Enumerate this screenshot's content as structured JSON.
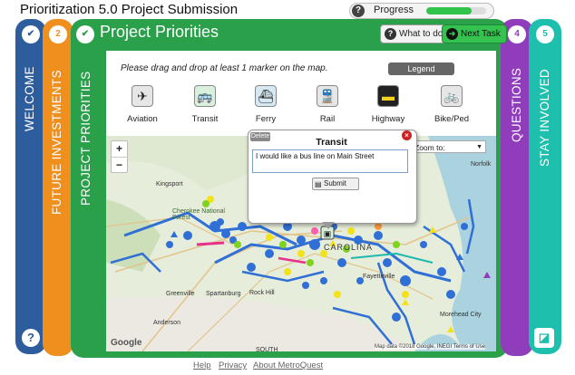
{
  "app": {
    "title": "Prioritization 5.0 Project Submission"
  },
  "progress": {
    "help_icon": "?",
    "label": "Progress",
    "fraction": 0.75
  },
  "tabs": {
    "welcome": {
      "label": "WELCOME",
      "badge": "✔"
    },
    "future": {
      "label": "FUTURE INVESTMENTS",
      "badge": "2"
    },
    "priorities": {
      "label": "PROJECT PRIORITIES",
      "badge": "✔"
    },
    "questions": {
      "label": "QUESTIONS",
      "badge": "4"
    },
    "stay": {
      "label": "STAY INVOLVED",
      "badge": "5"
    }
  },
  "panel": {
    "title": "Project Priorities",
    "what_to_do": "What to do",
    "next_task": "Next Task",
    "instruction": "Please drag and drop at least 1 marker on the map.",
    "legend": "Legend"
  },
  "markers": [
    {
      "label": "Aviation",
      "icon": "airplane-icon",
      "glyph": "✈",
      "bg": "#e6e6e6"
    },
    {
      "label": "Transit",
      "icon": "bus-icon",
      "glyph": "🚌",
      "bg": "#d9f0dc"
    },
    {
      "label": "Ferry",
      "icon": "ferry-icon",
      "glyph": "⛴",
      "bg": "#d6e8f2"
    },
    {
      "label": "Rail",
      "icon": "train-icon",
      "glyph": "🚆",
      "bg": "#e6e6e6"
    },
    {
      "label": "Highway",
      "icon": "highway-icon",
      "glyph": "▬",
      "bg": "#222222"
    },
    {
      "label": "Bike/Ped",
      "icon": "bike-ped-icon",
      "glyph": "🚲",
      "bg": "#e6e6e6"
    }
  ],
  "map": {
    "zoom_in": "+",
    "zoom_out": "−",
    "zoom_to": "Zoom to:",
    "google": "Google",
    "attribution": "Map data ©2018 Google, INEGI   Terms of Use",
    "places": [
      {
        "name": "Kingsport"
      },
      {
        "name": "Cherokee National Forest"
      },
      {
        "name": "Greenville"
      },
      {
        "name": "Spartanburg"
      },
      {
        "name": "Rock Hill"
      },
      {
        "name": "Anderson"
      },
      {
        "name": "Fayetteville"
      },
      {
        "name": "Morehead City"
      },
      {
        "name": "Norfolk"
      },
      {
        "name": "CAROLINA"
      },
      {
        "name": "SOUTH"
      }
    ]
  },
  "popup": {
    "delete": "Delete",
    "title": "Transit",
    "close": "×",
    "comment": "I would like a bus line on Main Street",
    "submit": "Submit"
  },
  "footer": {
    "help": "Help",
    "privacy": "Privacy",
    "about": "About MetroQuest"
  },
  "colors": {
    "welcome": "#2e5d9d",
    "future": "#ef8f1e",
    "active": "#2aa04b",
    "questions": "#8f3dbb",
    "stay": "#1fbfad",
    "progress_fill": "#31c44a"
  }
}
